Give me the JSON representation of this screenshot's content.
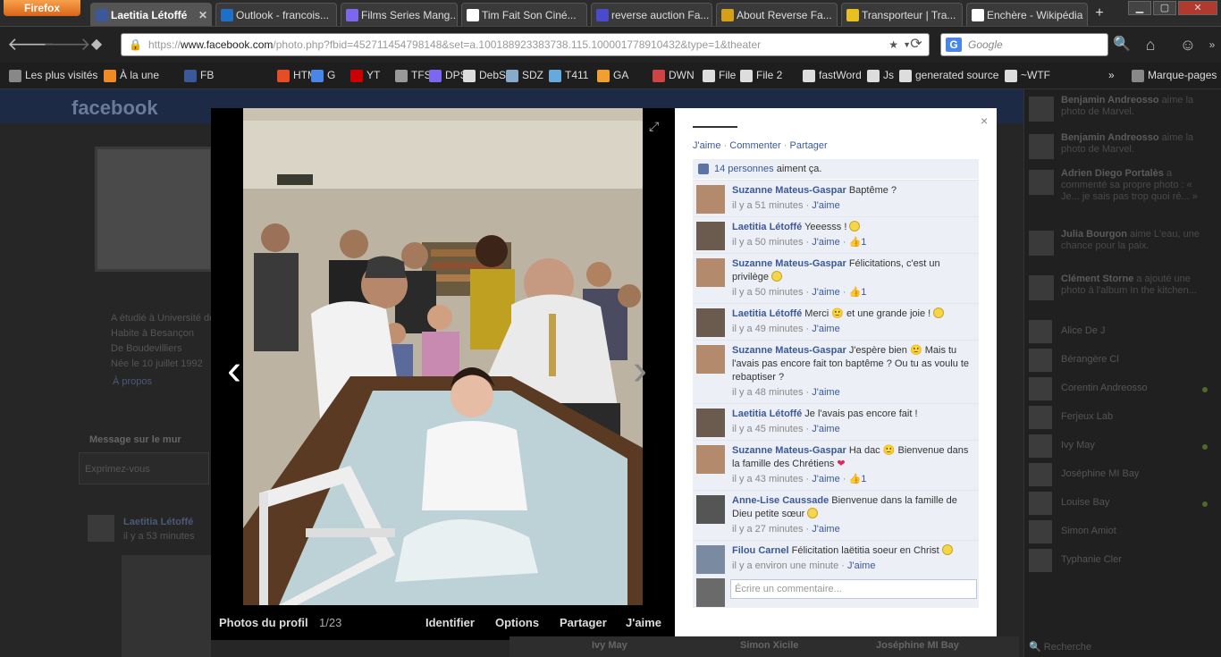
{
  "browser": {
    "menu_label": "Firefox",
    "tabs": [
      {
        "label": "Laetitia Létoffé",
        "active": true,
        "icon": "facebook-icon",
        "color": "#3b5998"
      },
      {
        "label": "Outlook - francois...",
        "active": false,
        "icon": "outlook-icon",
        "color": "#1f6fc7"
      },
      {
        "label": "Films Series Mang...",
        "active": false,
        "icon": "tv-icon",
        "color": "#7b68ee"
      },
      {
        "label": "Tim Fait Son Ciné...",
        "active": false,
        "icon": "document-icon",
        "color": "#ffffff"
      },
      {
        "label": "reverse auction Fa...",
        "active": false,
        "icon": "gear-icon",
        "color": "#4a4acc"
      },
      {
        "label": "About Reverse Fa...",
        "active": false,
        "icon": "cross-icon",
        "color": "#d4a017"
      },
      {
        "label": "Transporteur | Tra...",
        "active": false,
        "icon": "pin-icon",
        "color": "#e8c020"
      },
      {
        "label": "Enchère - Wikipédia",
        "active": false,
        "icon": "wikipedia-icon",
        "color": "#ffffff"
      }
    ],
    "new_tab": "+",
    "url_prefix": "https://",
    "url_host": "www.facebook.com",
    "url_path": "/photo.php?fbid=452711454798148&set=a.100188923383738.115.100001778910432&type=1&theater",
    "search_placeholder": "Google",
    "search_engine_letter": "G",
    "bookmarks": [
      {
        "label": "Les plus visités",
        "icon": "folder-icon",
        "color": "#888888"
      },
      {
        "label": "À la une",
        "icon": "rss-icon",
        "color": "#f08a24"
      },
      {
        "label": "FB",
        "icon": "facebook-icon",
        "color": "#3b5998"
      },
      {
        "label": "HTML",
        "icon": "html-icon",
        "color": "#e44d26"
      },
      {
        "label": "G",
        "icon": "google-icon",
        "color": "#4a86e8"
      },
      {
        "label": "YT",
        "icon": "youtube-icon",
        "color": "#cc0000"
      },
      {
        "label": "TFSC",
        "icon": "film-icon",
        "color": "#999999"
      },
      {
        "label": "DPStr",
        "icon": "tv-icon",
        "color": "#7b68ee"
      },
      {
        "label": "DebStr",
        "icon": "document-icon",
        "color": "#dddddd"
      },
      {
        "label": "SDZ",
        "icon": "bird-icon",
        "color": "#88aacc"
      },
      {
        "label": "T411",
        "icon": "t411-icon",
        "color": "#66aadd"
      },
      {
        "label": "GA",
        "icon": "analytics-icon",
        "color": "#f0a030"
      },
      {
        "label": "DWN",
        "icon": "download-icon",
        "color": "#cc4444"
      },
      {
        "label": "File",
        "icon": "document-icon",
        "color": "#dddddd"
      },
      {
        "label": "File 2",
        "icon": "document-icon",
        "color": "#dddddd"
      },
      {
        "label": "fastWord",
        "icon": "document-icon",
        "color": "#dddddd"
      },
      {
        "label": "Js",
        "icon": "document-icon",
        "color": "#dddddd"
      },
      {
        "label": "generated source",
        "icon": "document-icon",
        "color": "#dddddd"
      },
      {
        "label": "~WTF",
        "icon": "document-icon",
        "color": "#dddddd"
      }
    ],
    "bookmarks_overflow": "»",
    "bookmarks_menu": "Marque-pages"
  },
  "background": {
    "logo": "facebook",
    "about": [
      "A étudié à Université de",
      "Habite à Besançon",
      "De Boudevilliers",
      "Née le 10 juillet 1992"
    ],
    "about_link": "À propos",
    "wall_label": "Message sur le mur",
    "wall_placeholder": "Exprimez-vous",
    "post_author": "Laetitia Létoffé",
    "post_time": "il y a 53 minutes",
    "ticker": [
      {
        "name": "Benjamin Andreosso",
        "text": " aime la photo de Marvel."
      },
      {
        "name": "Benjamin Andreosso",
        "text": " aime la photo de Marvel."
      },
      {
        "name": "Adrien Diego Portalès",
        "text": " a commenté sa propre photo : « Je... je sais pas trop quoi ré... »"
      },
      {
        "name": "Julia Bourgon",
        "text": " aime L'eau, une chance pour la paix."
      },
      {
        "name": "Clément Storne",
        "text": " a ajouté une photo à l'album In the kitchen..."
      }
    ],
    "chat": [
      {
        "name": "Alice De J",
        "online": false
      },
      {
        "name": "Bérangère Cl",
        "online": false
      },
      {
        "name": "Corentin Andreosso",
        "online": true
      },
      {
        "name": "Ferjeux Lab",
        "online": false
      },
      {
        "name": "Ivy May",
        "online": true
      },
      {
        "name": "Joséphine MI Bay",
        "online": false
      },
      {
        "name": "Louise Bay",
        "online": true
      },
      {
        "name": "Simon Amiot",
        "online": false
      },
      {
        "name": "Typhanie Cler",
        "online": false
      }
    ],
    "chat_search": "Recherche",
    "chat_tabs": [
      "Ivy May",
      "Simon Xicile",
      "Joséphine MI Bay"
    ]
  },
  "theater": {
    "album": "Photos du profil",
    "counter": "1/23",
    "actions": [
      "Identifier",
      "Options",
      "Partager",
      "J'aime"
    ],
    "prev": "‹",
    "next": "›"
  },
  "side": {
    "close": "×",
    "actions": [
      "J'aime",
      "Commenter",
      "Partager"
    ],
    "likes_count": "14 personnes",
    "likes_text": " aiment ça.",
    "comments": [
      {
        "name": "Suzanne Mateus-Gaspar",
        "text": "Baptême ?",
        "smiley": false,
        "heart": false,
        "time": "il y a 51 minutes",
        "like": "J'aime",
        "likes": ""
      },
      {
        "name": "Laetitia Létoffé",
        "text": "Yeeesss !",
        "smiley": true,
        "heart": false,
        "time": "il y a 50 minutes",
        "like": "J'aime",
        "likes": "1"
      },
      {
        "name": "Suzanne Mateus-Gaspar",
        "text": "Félicitations, c'est un privilège",
        "smiley": true,
        "heart": false,
        "time": "il y a 50 minutes",
        "like": "J'aime",
        "likes": "1"
      },
      {
        "name": "Laetitia Létoffé",
        "text": "Merci 🙂 et une grande joie !",
        "smiley": true,
        "heart": false,
        "time": "il y a 49 minutes",
        "like": "J'aime",
        "likes": ""
      },
      {
        "name": "Suzanne Mateus-Gaspar",
        "text": "J'espère bien 🙂 Mais tu l'avais pas encore fait ton baptême ? Ou tu as voulu te rebaptiser ?",
        "smiley": false,
        "heart": false,
        "time": "il y a 48 minutes",
        "like": "J'aime",
        "likes": ""
      },
      {
        "name": "Laetitia Létoffé",
        "text": "Je l'avais pas encore fait !",
        "smiley": false,
        "heart": false,
        "time": "il y a 45 minutes",
        "like": "J'aime",
        "likes": ""
      },
      {
        "name": "Suzanne Mateus-Gaspar",
        "text": "Ha dac 🙂 Bienvenue dans la famille des Chrétiens",
        "smiley": false,
        "heart": true,
        "time": "il y a 43 minutes",
        "like": "J'aime",
        "likes": "1"
      },
      {
        "name": "Anne-Lise Caussade",
        "text": "Bienvenue dans la famille de Dieu petite sœur",
        "smiley": true,
        "heart": false,
        "time": "il y a 27 minutes",
        "like": "J'aime",
        "likes": ""
      },
      {
        "name": "Filou Carnel",
        "text": "Félicitation laëtitia soeur en Christ",
        "smiley": true,
        "heart": false,
        "time": "il y a environ une minute",
        "like": "J'aime",
        "likes": ""
      }
    ],
    "comment_placeholder": "Écrire un commentaire..."
  }
}
